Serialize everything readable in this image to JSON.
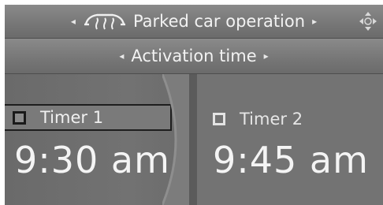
{
  "header": {
    "title": "Parked car operation",
    "car_icon": "parked-car-climate-icon",
    "corner_icon": "rotary-controller-icon"
  },
  "subheader": {
    "title": "Activation time"
  },
  "timers": [
    {
      "label": "Timer 1",
      "time": "9:30 am",
      "selected": true
    },
    {
      "label": "Timer 2",
      "time": "9:45 am",
      "selected": false
    }
  ],
  "colors": {
    "panel": "#737373",
    "text": "#f2f2f2",
    "selection_border": "#1e1e1e"
  }
}
